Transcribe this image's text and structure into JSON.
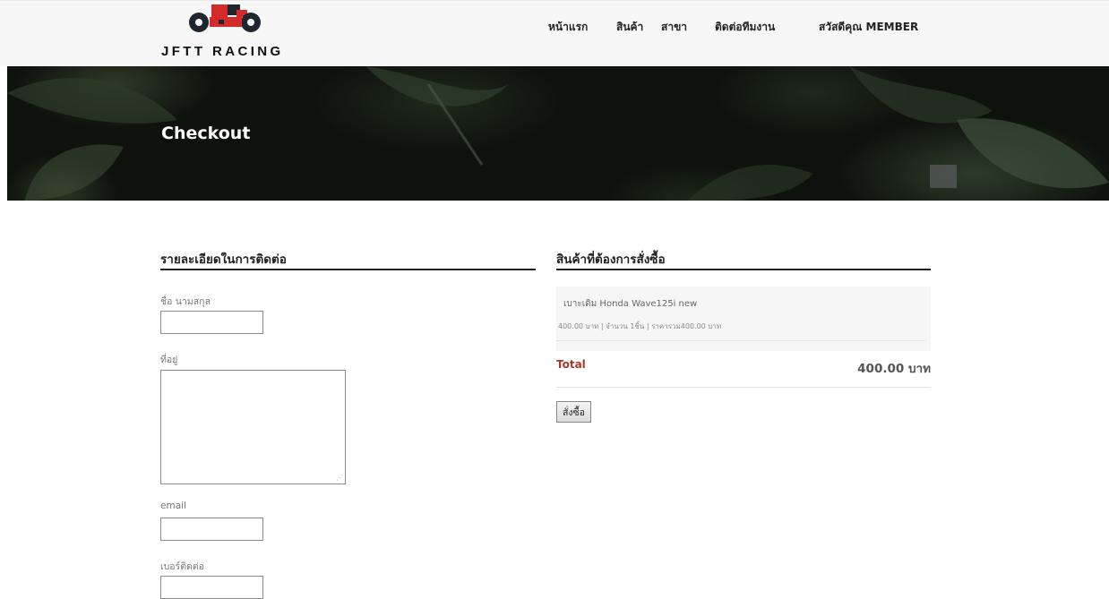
{
  "header": {
    "logo_text": "JFTT RACING",
    "nav": [
      "หน้าแรก",
      "สินค้า",
      "สาขา",
      "ติดต่อทีมงาน",
      "สวัสดีคุณ MEMBER"
    ]
  },
  "hero": {
    "title": "Checkout"
  },
  "contact": {
    "section_title": "รายละเอียดในการติดต่อ",
    "fields": {
      "name_label": "ชื่อ นามสกุล",
      "name_value": "",
      "address_label": "ที่อยู่",
      "address_value": "",
      "email_label": "email",
      "email_value": "",
      "phone_label": "เบอร์ติดต่อ",
      "phone_value": ""
    }
  },
  "order": {
    "section_title": "สินค้าที่ต้องการสั่งซื้อ",
    "item": {
      "name": "เบาะเดิม Honda Wave125i new",
      "meta": "400.00 บาท  |  จำนวน 1ชิ้น  |  ราคารวม400.00 บาท"
    },
    "total_label": "Total",
    "total_value": "400.00 บาท",
    "submit_label": "สั่งซื้อ"
  },
  "colors": {
    "total_label": "#a33a2c",
    "hero_bg": "#0e120d",
    "logo_red": "#d42a2a",
    "logo_dark": "#1f2630"
  }
}
